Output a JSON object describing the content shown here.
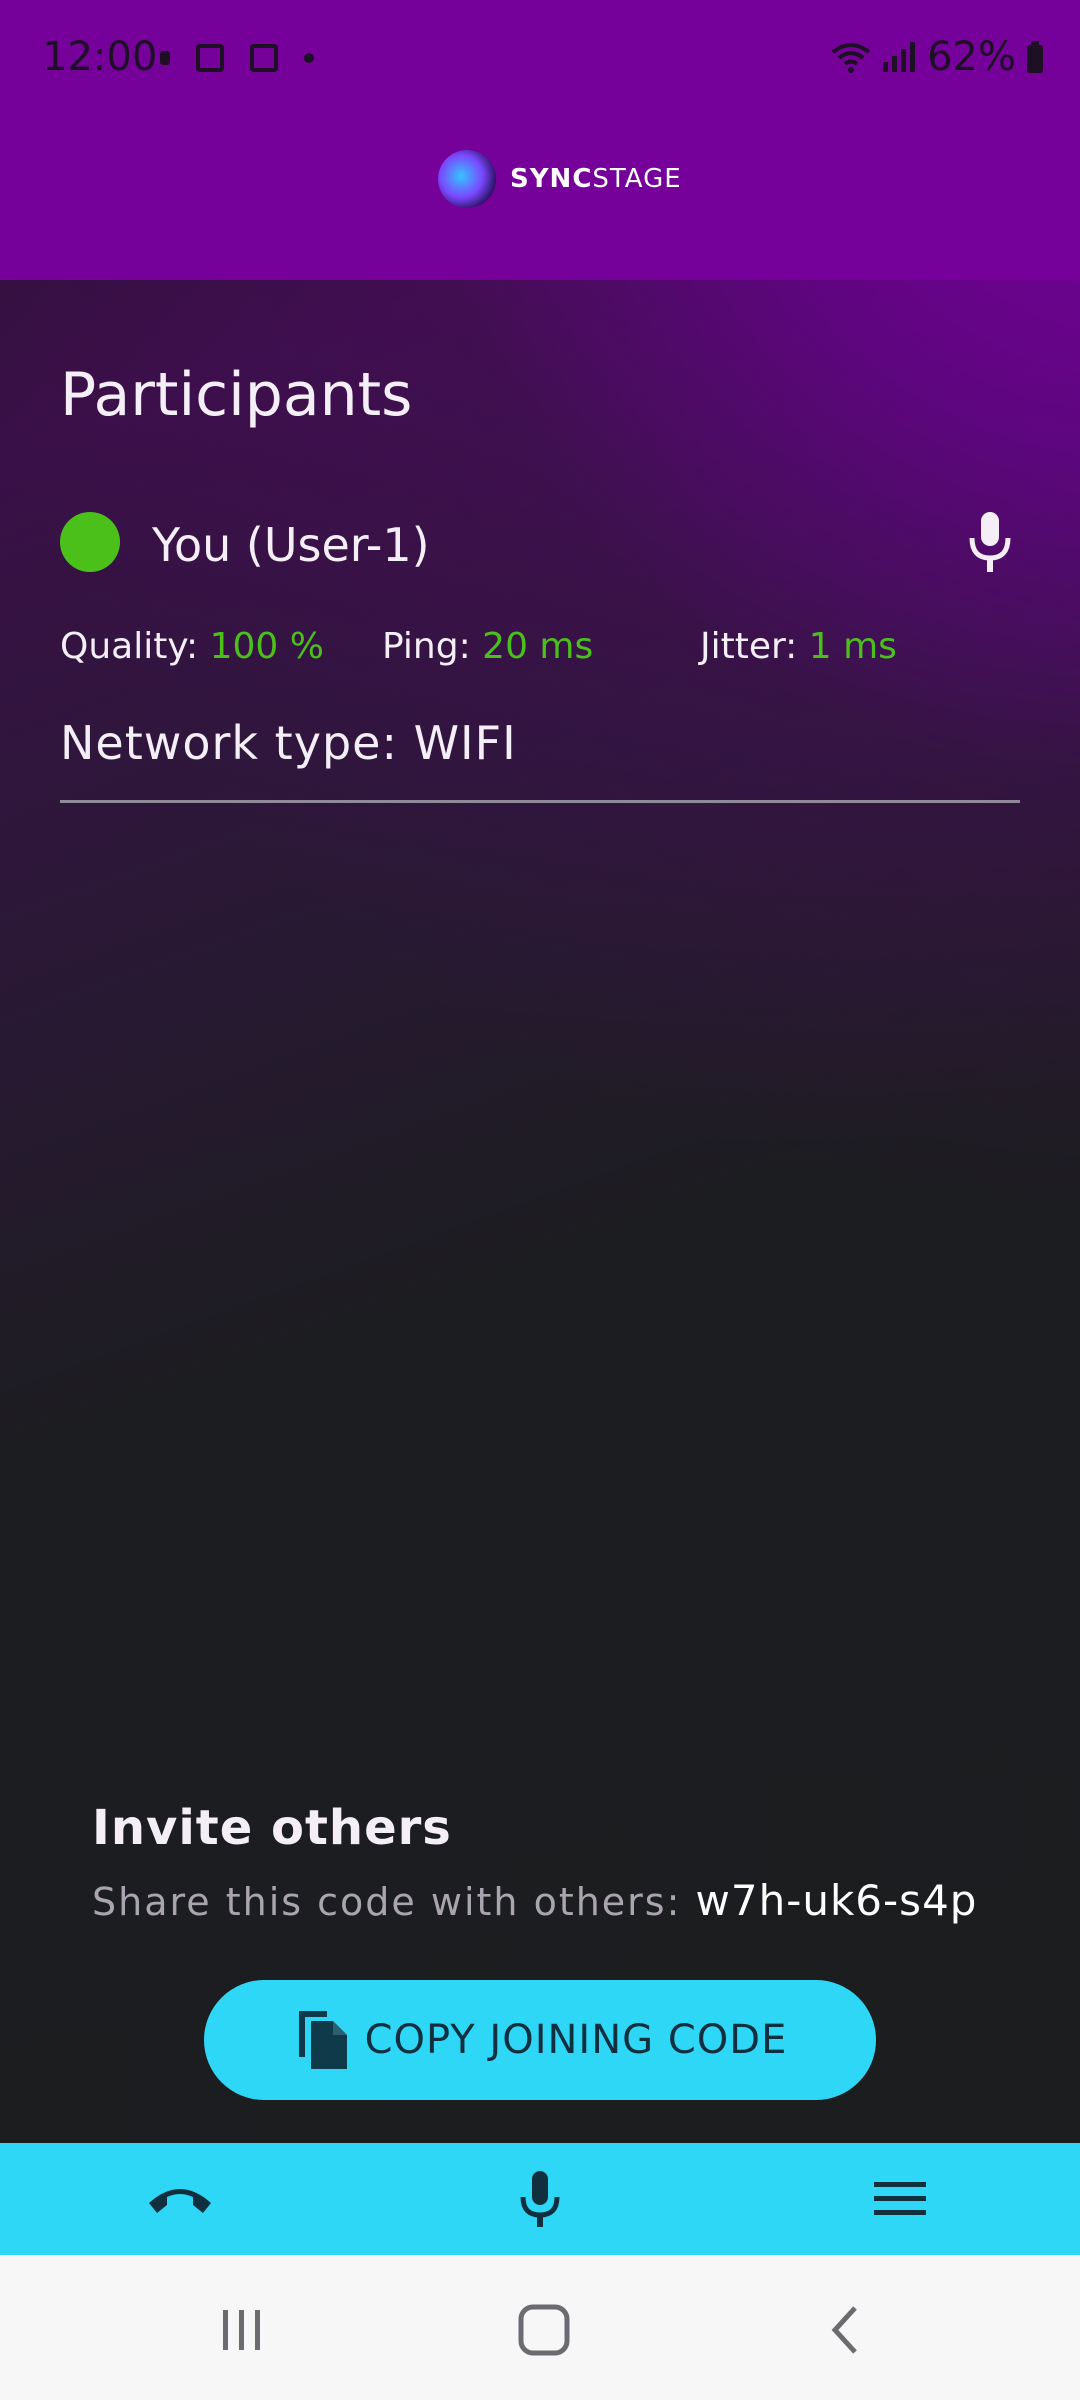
{
  "status_bar": {
    "time": "12:00",
    "battery": "62%",
    "icons": [
      "notification-dot-icon",
      "image-icon",
      "square-app-icon",
      "dot-icon",
      "wifi-icon",
      "signal-icon",
      "battery-icon"
    ]
  },
  "header": {
    "logo_bold": "SYNC",
    "logo_light": "STAGE"
  },
  "participants": {
    "title": "Participants",
    "items": [
      {
        "name": "You (User-1)",
        "status_color": "#4cc01a",
        "quality_label": "Quality:",
        "quality_value": "100 %",
        "ping_label": "Ping:",
        "ping_value": "20 ms",
        "jitter_label": "Jitter:",
        "jitter_value": "1 ms",
        "network_label": "Network type: WIFI"
      }
    ]
  },
  "invite": {
    "title": "Invite others",
    "text": "Share this code with others:",
    "code": "w7h-uk6-s4p",
    "copy_button": "COPY JOINING CODE"
  },
  "bottom_nav": {
    "items": [
      "hang-up-icon",
      "microphone-icon",
      "menu-icon"
    ]
  },
  "colors": {
    "accent": "#2fd7f7",
    "header": "#75009a",
    "good": "#4cc01a"
  }
}
